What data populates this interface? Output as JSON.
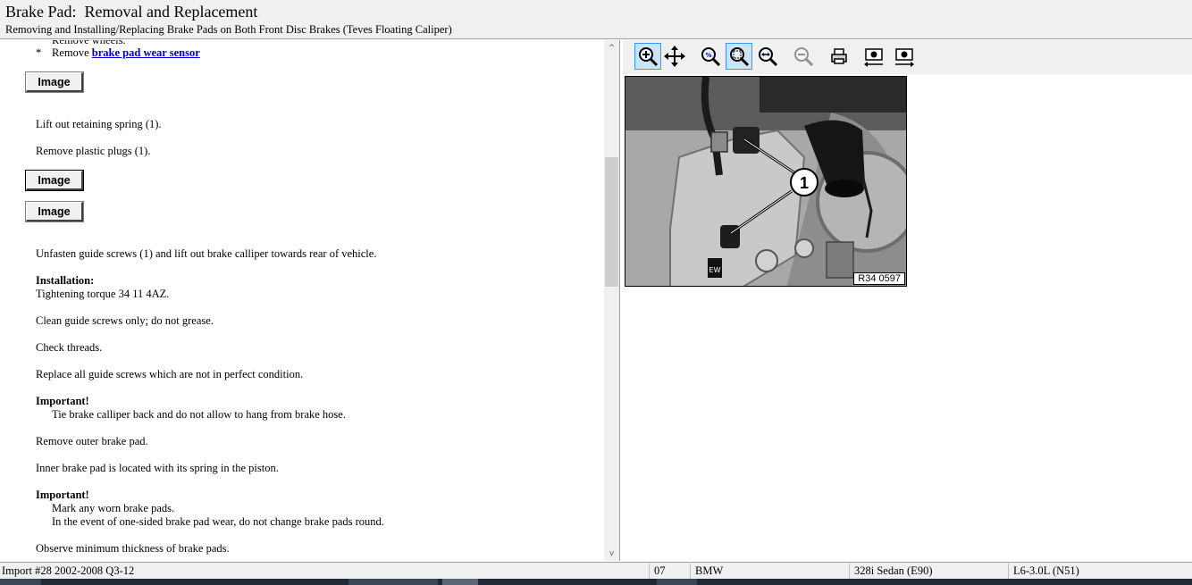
{
  "header": {
    "title": "Brake Pad:  Removal and Replacement",
    "subtitle": "Removing and Installing/Replacing Brake Pads on Both Front Disc Brakes (Teves Floating Caliper)"
  },
  "procedure": {
    "partial_line": "Remove wheels.",
    "bullet_star": "*",
    "bullet_prefix": "Remove ",
    "bullet_link": "brake pad wear sensor",
    "image_button_label": "Image",
    "steps": {
      "lift_spring": "Lift out retaining spring (1).",
      "remove_plugs": "Remove plastic plugs (1).",
      "unfasten": "Unfasten guide screws (1) and lift out brake calliper towards rear of vehicle.",
      "installation_heading": "Installation:",
      "torque": "Tightening torque 34 11 4AZ.",
      "clean": "Clean guide screws only; do not grease.",
      "check": "Check threads.",
      "replace": "Replace all guide screws which are not in perfect condition.",
      "important1_heading": "Important!",
      "important1_text": "Tie brake calliper back and do not allow to hang from brake hose.",
      "remove_outer": "Remove outer brake pad.",
      "inner_pad": "Inner brake pad is located with its spring in the piston.",
      "important2_heading": "Important!",
      "important2_line1": "Mark any worn brake pads.",
      "important2_line2": "In the event of one-sided brake pad wear, do not change brake pads round.",
      "observe": "Observe minimum thickness of brake pads."
    }
  },
  "scrollbar": {
    "up_glyph": "^",
    "down_glyph": "v"
  },
  "toolbar": {
    "icons": [
      "zoom-in-icon",
      "pan-icon",
      "zoom-100-icon",
      "zoom-fit-icon",
      "zoom-area-icon",
      "zoom-out-icon",
      "print-icon",
      "previous-image-icon",
      "next-image-icon"
    ]
  },
  "figure": {
    "callout": "1",
    "label": "R34 0597",
    "stamp": "EW"
  },
  "statusbar": {
    "import": "Import #28 2002-2008 Q3-12",
    "year": "07",
    "make": "BMW",
    "model": "328i Sedan (E90)",
    "engine": "L6-3.0L (N51)"
  }
}
